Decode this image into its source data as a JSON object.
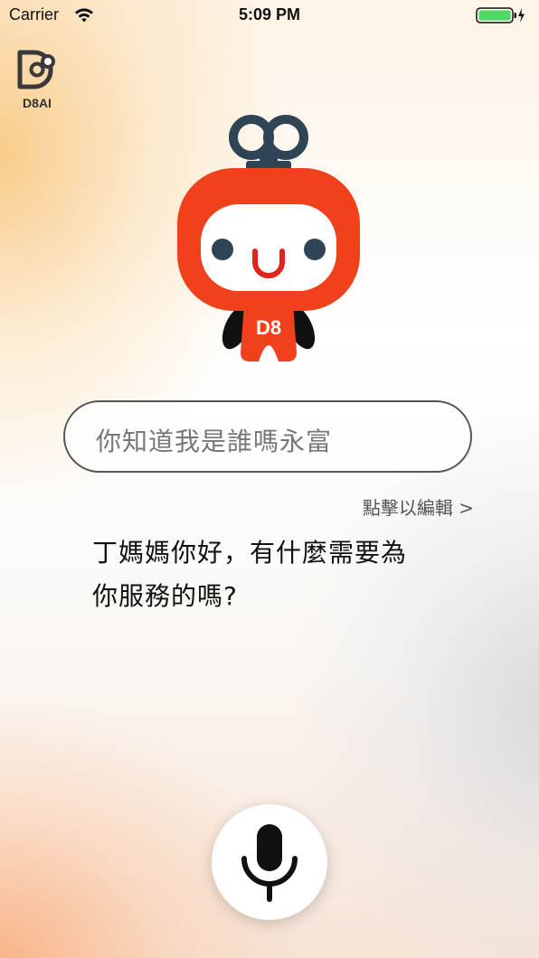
{
  "status_bar": {
    "carrier": "Carrier",
    "time": "5:09 PM",
    "battery_color": "#4cd964"
  },
  "logo": {
    "label": "D8AI"
  },
  "mascot": {
    "badge": "D8",
    "body_color": "#f0401c",
    "eye_color": "#2f4454"
  },
  "input": {
    "text": "你知道我是誰嗎永富"
  },
  "edit_link": "點擊以編輯 >",
  "reply": {
    "line1": "丁媽媽你好，有什麼需要為",
    "line2": "你服務的嗎?"
  },
  "mic": {
    "icon": "microphone-icon"
  }
}
